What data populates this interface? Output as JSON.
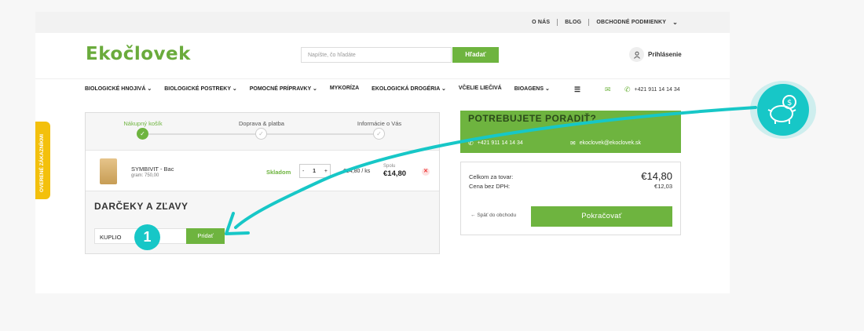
{
  "topbar": {
    "links": [
      "O NÁS",
      "BLOG",
      "OBCHODNÉ PODMIENKY"
    ]
  },
  "header": {
    "logo": "Ekočlovek",
    "search_placeholder": "Napíšte, čo hľadáte",
    "search_button": "Hľadať",
    "login": "Prihlásenie"
  },
  "nav": {
    "items": [
      "BIOLOGICKÉ HNOJIVÁ ⌄",
      "BIOLOGICKÉ POSTREKY ⌄",
      "POMOCNÉ PRÍPRAVKY ⌄",
      "MYKORÍZA",
      "EKOLOGICKÁ DROGÉRIA ⌄",
      "VČELIE LIEČIVÁ",
      "BIOAGENS ⌄"
    ],
    "phone": "+421 911 14 14 34"
  },
  "steps": [
    "Nákupný košík",
    "Doprava & platba",
    "Informácie o Vás"
  ],
  "cart_item": {
    "name": "SYMBIVIT - Bac",
    "gram": "gram: 750,00",
    "stock": "Skladom",
    "qty": "1",
    "unit_price": "€14,80 / ks",
    "sum_label": "Spolu",
    "total": "€14,80"
  },
  "gifts": {
    "title": "DARČEKY A ZĽAVY",
    "code": "KUPLIO",
    "add_button": "Pridať"
  },
  "help": {
    "title": "POTREBUJETE PORADIŤ?",
    "phone": "+421 911 14 14 34",
    "email": "ekoclovek@ekoclovek.sk"
  },
  "summary": {
    "total_label": "Celkom za tovar:",
    "total_value": "€14,80",
    "net_label": "Cena bez DPH:",
    "net_value": "€12,03",
    "back": "Späť do obchodu",
    "continue": "Pokračovať"
  },
  "side_tab": "OVERENÉ ZÁKAZNÍKMI",
  "badge": "1",
  "colors": {
    "green": "#6eb43f",
    "teal": "#17c7c7",
    "yellow": "#f3c00c"
  },
  "icons": [
    "user-icon",
    "menu-icon",
    "mail-icon",
    "phone-icon",
    "check-icon",
    "remove-icon",
    "piggy-bank-icon",
    "arrow-left-icon"
  ]
}
